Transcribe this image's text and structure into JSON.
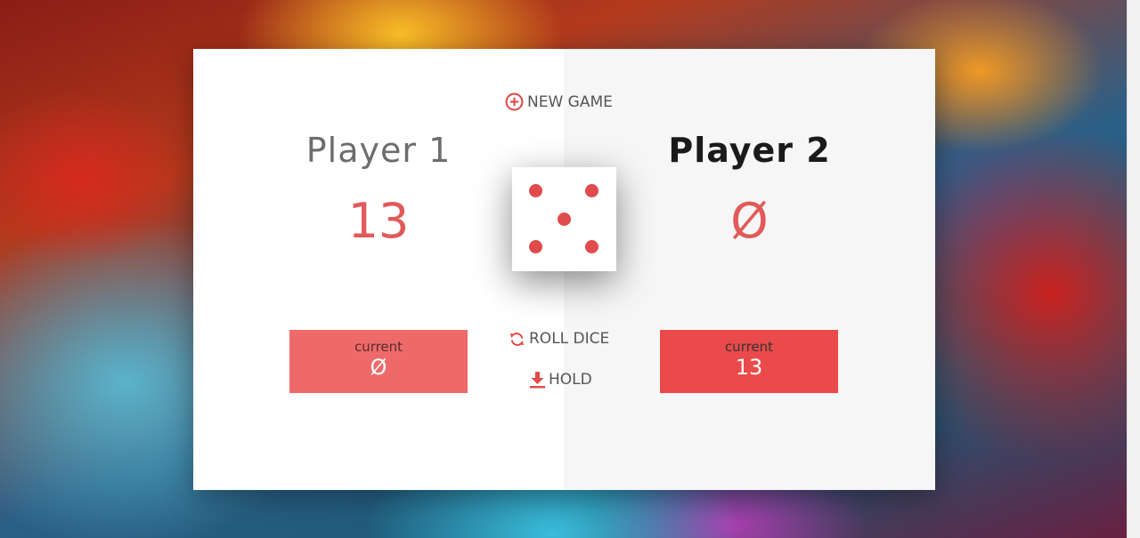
{
  "colors": {
    "accent": "#e15a5a",
    "active_current_box": "#ea4a4a",
    "inactive_current_box": "#ee6a6a",
    "active_panel": "#f6f6f6",
    "inactive_panel": "#ffffff",
    "pip": "#e14b4b"
  },
  "controls": {
    "new_game": {
      "label": "NEW GAME",
      "icon": "plus-circle-icon"
    },
    "roll_dice": {
      "label": "ROLL DICE",
      "icon": "refresh-icon"
    },
    "hold": {
      "label": "HOLD",
      "icon": "download-icon"
    }
  },
  "dice": {
    "value": 5
  },
  "players": [
    {
      "name": "Player 1",
      "score": "13",
      "current_label": "current",
      "current_score": "Ø",
      "active": false
    },
    {
      "name": "Player 2",
      "score": "Ø",
      "current_label": "current",
      "current_score": "13",
      "active": true
    }
  ]
}
